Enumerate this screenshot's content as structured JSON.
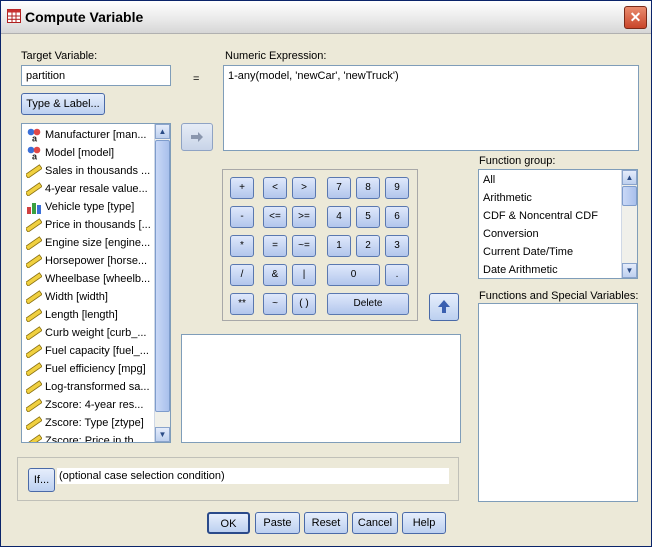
{
  "window": {
    "title": "Compute Variable",
    "close_glyph": "✕"
  },
  "target": {
    "label": "Target Variable:",
    "value": "partition",
    "type_label_button": "Type & Label..."
  },
  "equals_sign": "=",
  "expression": {
    "label": "Numeric Expression:",
    "value": "1-any(model, 'newCar', 'newTruck')"
  },
  "variables": [
    {
      "label": "Manufacturer [man...",
      "icon": "nominal-string-icon"
    },
    {
      "label": "Model [model]",
      "icon": "nominal-string-icon"
    },
    {
      "label": "Sales in thousands ...",
      "icon": "scale-ruler-icon"
    },
    {
      "label": "4-year resale value...",
      "icon": "scale-ruler-icon"
    },
    {
      "label": "Vehicle type [type]",
      "icon": "bar-chart-icon"
    },
    {
      "label": "Price in thousands [...",
      "icon": "scale-ruler-icon"
    },
    {
      "label": "Engine size [engine...",
      "icon": "scale-ruler-icon"
    },
    {
      "label": "Horsepower [horse...",
      "icon": "scale-ruler-icon"
    },
    {
      "label": "Wheelbase [wheelb...",
      "icon": "scale-ruler-icon"
    },
    {
      "label": "Width [width]",
      "icon": "scale-ruler-icon"
    },
    {
      "label": "Length [length]",
      "icon": "scale-ruler-icon"
    },
    {
      "label": "Curb weight [curb_...",
      "icon": "scale-ruler-icon"
    },
    {
      "label": "Fuel capacity [fuel_...",
      "icon": "scale-ruler-icon"
    },
    {
      "label": "Fuel efficiency [mpg]",
      "icon": "scale-ruler-icon"
    },
    {
      "label": "Log-transformed sa...",
      "icon": "scale-ruler-icon"
    },
    {
      "label": "Zscore:  4-year res...",
      "icon": "scale-ruler-icon"
    },
    {
      "label": "Zscore:  Type [ztype]",
      "icon": "scale-ruler-icon"
    },
    {
      "label": "Zscore:  Price in th...",
      "icon": "scale-ruler-icon"
    }
  ],
  "keypad": {
    "r1": [
      "+",
      "<",
      ">",
      "7",
      "8",
      "9"
    ],
    "r2": [
      "-",
      "<=",
      ">=",
      "4",
      "5",
      "6"
    ],
    "r3": [
      "*",
      "=",
      "~=",
      "1",
      "2",
      "3"
    ],
    "r4": [
      "/",
      "&",
      "|",
      "0",
      "."
    ],
    "r5": [
      "**",
      "~",
      "( )",
      "Delete"
    ]
  },
  "function_group": {
    "label": "Function group:",
    "items": [
      "All",
      "Arithmetic",
      "CDF & Noncentral CDF",
      "Conversion",
      "Current Date/Time",
      "Date Arithmetic"
    ]
  },
  "functions_label": "Functions and Special Variables:",
  "if_section": {
    "button": "If...",
    "text": "(optional case selection condition)"
  },
  "buttons": {
    "ok": "OK",
    "paste": "Paste",
    "reset": "Reset",
    "cancel": "Cancel",
    "help": "Help"
  }
}
